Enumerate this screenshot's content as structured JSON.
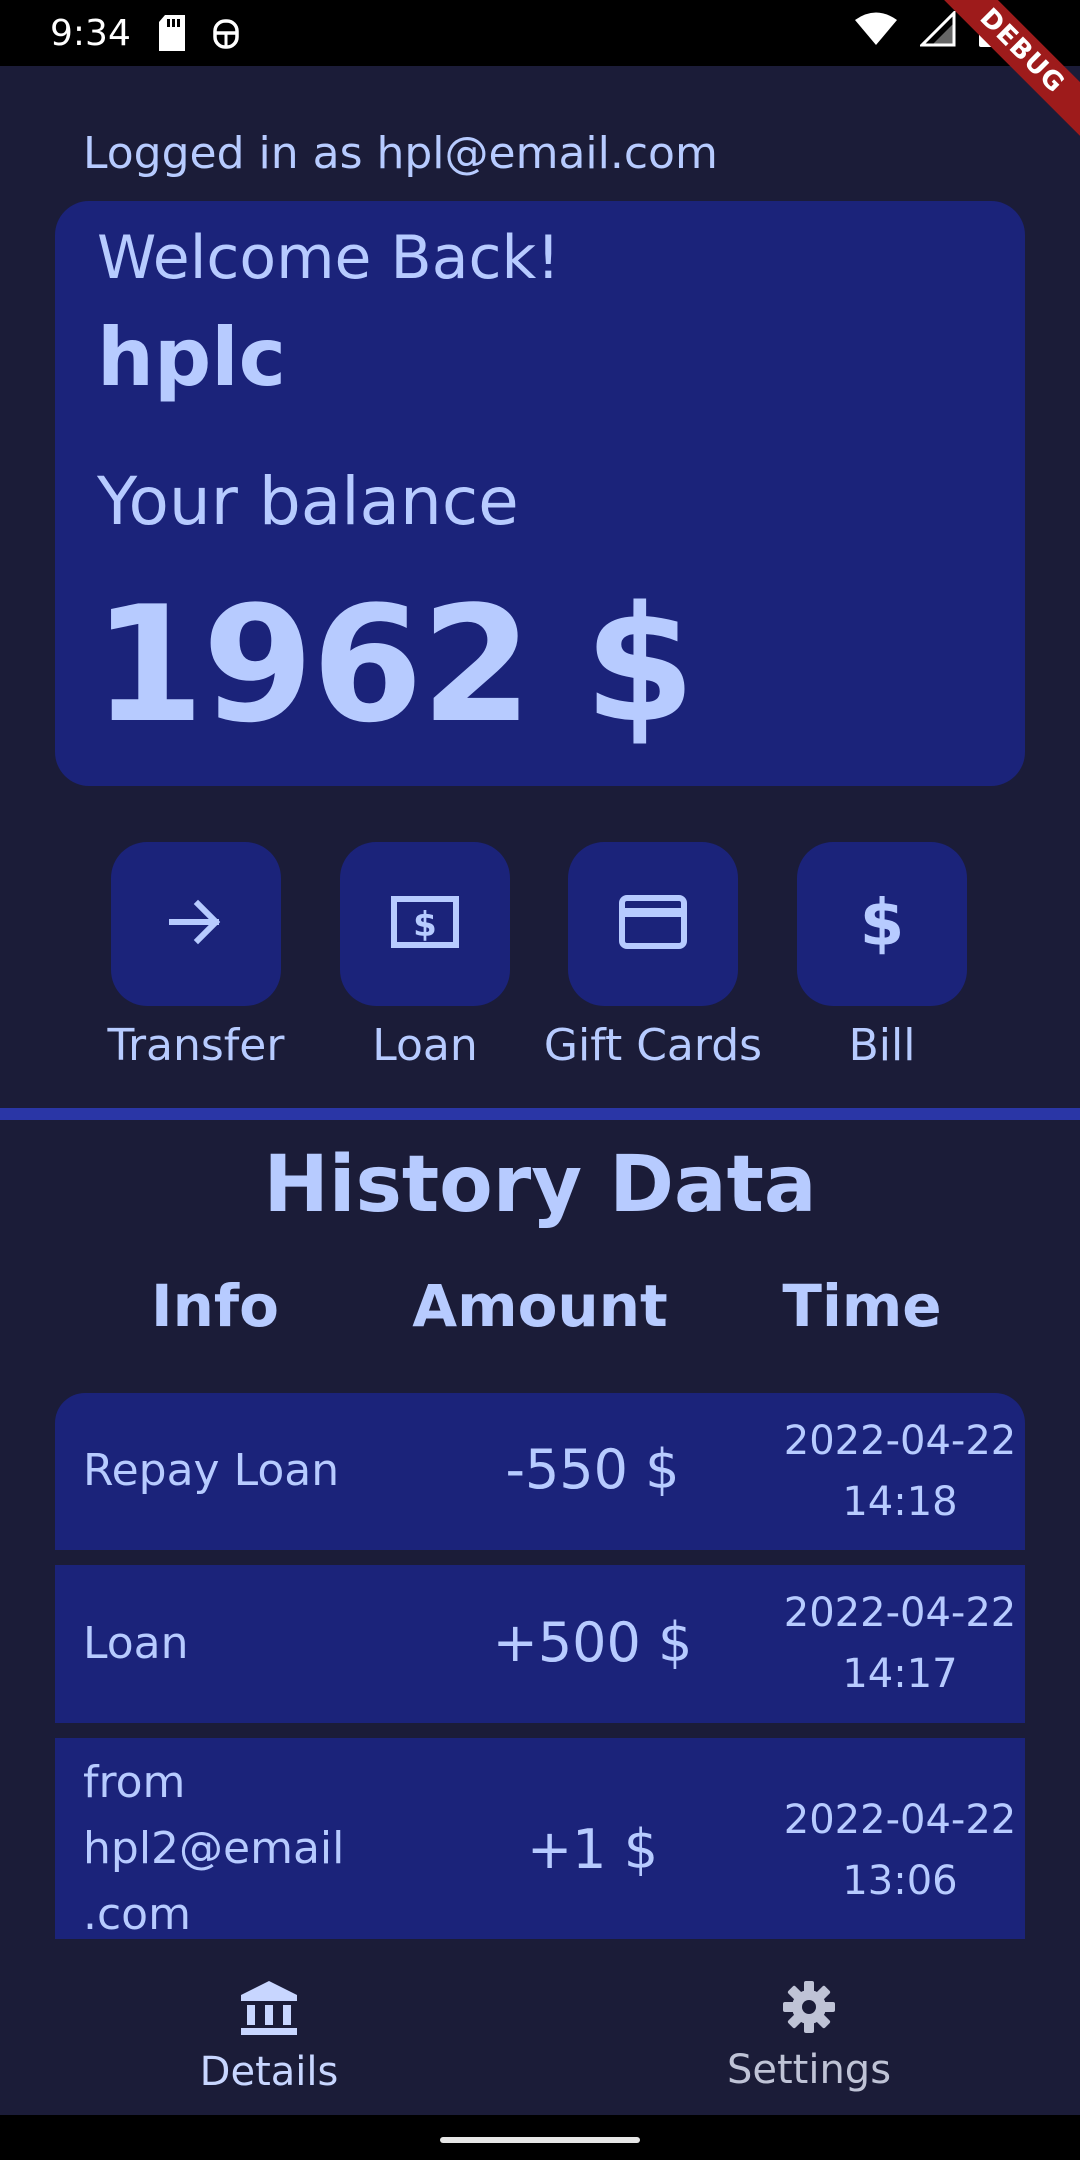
{
  "status_bar": {
    "time": "9:34"
  },
  "debug_banner": "DEBUG",
  "account": {
    "logged_in_text": "Logged in as hpl@email.com"
  },
  "balance_card": {
    "welcome": "Welcome Back!",
    "username": "hplc",
    "balance_label": "Your balance",
    "balance": "1962 $"
  },
  "actions": [
    {
      "label": "Transfer",
      "icon": "arrow-right-icon"
    },
    {
      "label": "Loan",
      "icon": "money-icon"
    },
    {
      "label": "Gift Cards",
      "icon": "credit-card-icon"
    },
    {
      "label": "Bill",
      "icon": "dollar-icon"
    }
  ],
  "history": {
    "title": "History Data",
    "columns": [
      "Info",
      "Amount",
      "Time"
    ],
    "rows": [
      {
        "info": "Repay Loan",
        "amount": "-550 $",
        "date": "2022-04-22",
        "time": "14:18"
      },
      {
        "info": "Loan",
        "amount": "+500 $",
        "date": "2022-04-22",
        "time": "14:17"
      },
      {
        "info": "from hpl2@email .com",
        "info_lines": [
          "from",
          "hpl2@email",
          ".com"
        ],
        "amount": "+1 $",
        "date": "2022-04-22",
        "time": "13:06"
      }
    ]
  },
  "bottom_nav": {
    "items": [
      {
        "label": "Details",
        "icon": "bank-icon",
        "active": true
      },
      {
        "label": "Settings",
        "icon": "gear-icon",
        "active": false
      }
    ]
  },
  "colors": {
    "background": "#1b1c38",
    "card": "#1b237a",
    "accent_text": "#b7cbff",
    "divider": "#2a36a6"
  }
}
